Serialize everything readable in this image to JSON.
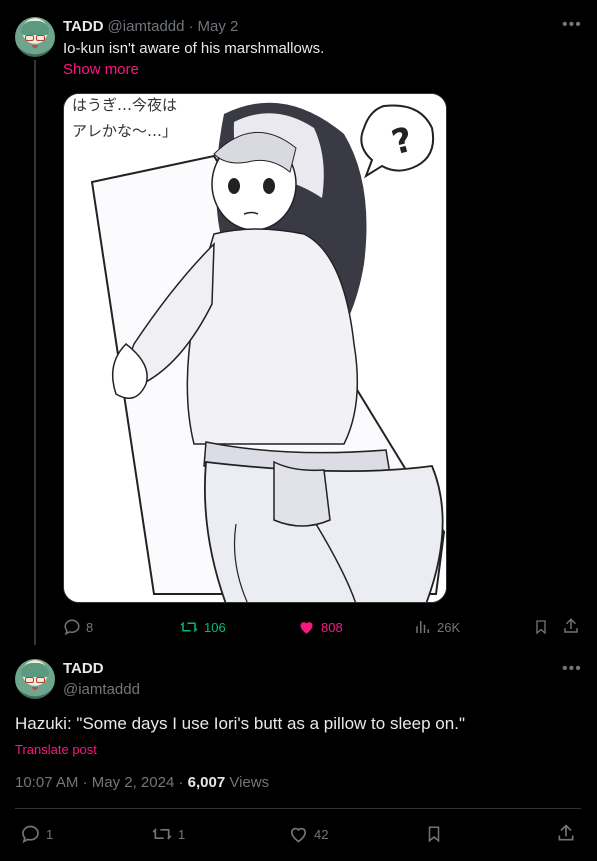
{
  "post1": {
    "author_name": "TADD",
    "handle": "@iamtaddd",
    "separator": "·",
    "date": "May 2",
    "text": "Io-kun isn't aware of his marshmallows.",
    "show_more": "Show more",
    "image_caption_jp_line1": "はうぎ…今夜は",
    "image_caption_jp_line2": "アレかな〜…」",
    "actions": {
      "replies": "8",
      "reposts": "106",
      "likes": "808",
      "views": "26K"
    },
    "colors": {
      "repost": "#00ba7c",
      "like": "#f91880"
    }
  },
  "post2": {
    "author_name": "TADD",
    "handle": "@iamtaddd",
    "text": "Hazuki: \"Some days I use Iori's butt as a pillow to sleep on.\"",
    "translate": "Translate post",
    "time": "10:07 AM",
    "separator": "·",
    "date": "May 2, 2024",
    "separator2": "·",
    "views_count": "6,007",
    "views_label": "Views",
    "actions": {
      "replies": "1",
      "reposts": "1",
      "likes": "42"
    }
  },
  "icons": [
    "more-icon",
    "reply-icon",
    "repost-icon",
    "like-icon",
    "views-icon",
    "bookmark-icon",
    "share-icon"
  ],
  "theme": {
    "background": "#000000",
    "text": "#e7e9ea",
    "muted": "#71767b",
    "accent_pink": "#f91880"
  }
}
